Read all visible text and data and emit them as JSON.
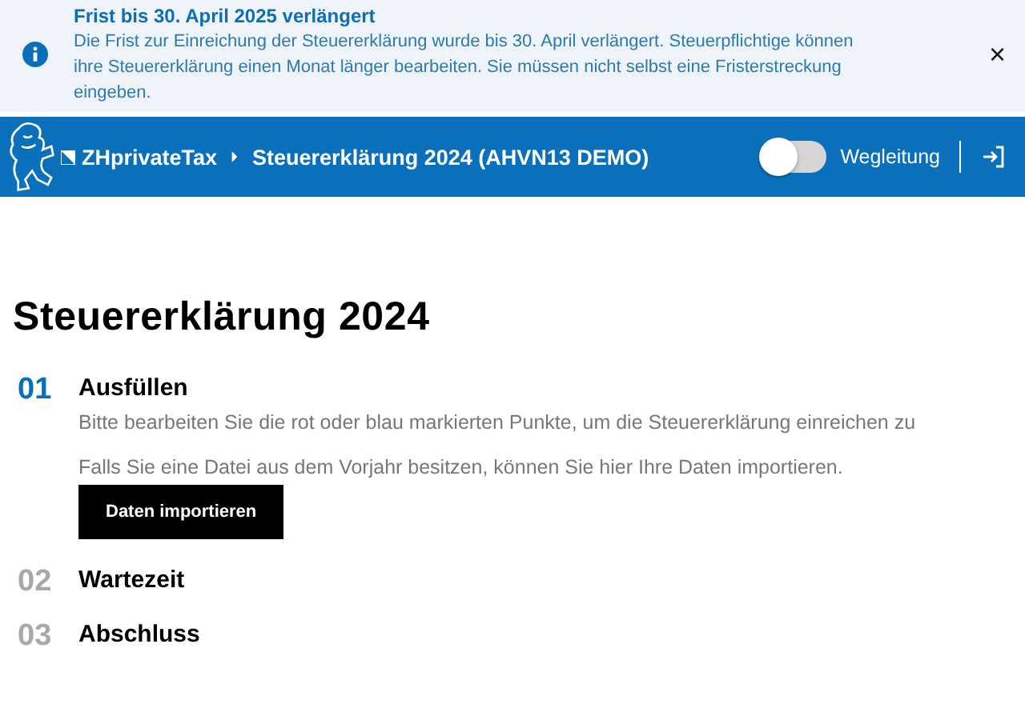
{
  "notice": {
    "title": "Frist bis 30. April 2025 verlängert",
    "text": "Die Frist zur Einreichung der Steuererklärung wurde bis 30. April verlängert. Steuerpflichtige können ihre Steuererklärung einen Monat länger bearbeiten. Sie müssen nicht selbst eine Fristerstreckung eingeben.",
    "close": "×"
  },
  "header": {
    "breadcrumbs": [
      "ZHprivateTax",
      "Steuererklärung 2024 (AHVN13 DEMO)"
    ],
    "guide_toggle": {
      "label": "Wegleitung",
      "on": false
    }
  },
  "page_title": "Steuererklärung 2024",
  "steps": [
    {
      "number": "01",
      "title": "Ausfüllen",
      "active": true,
      "paragraphs": [
        "Bitte bearbeiten Sie die rot oder blau markierten Punkte, um die Steuererklärung einreichen zu",
        "Falls Sie eine Datei aus dem Vorjahr besitzen, können Sie hier Ihre Daten importieren."
      ],
      "button": "Daten importieren"
    },
    {
      "number": "02",
      "title": "Wartezeit",
      "active": false
    },
    {
      "number": "03",
      "title": "Abschluss",
      "active": false
    }
  ]
}
